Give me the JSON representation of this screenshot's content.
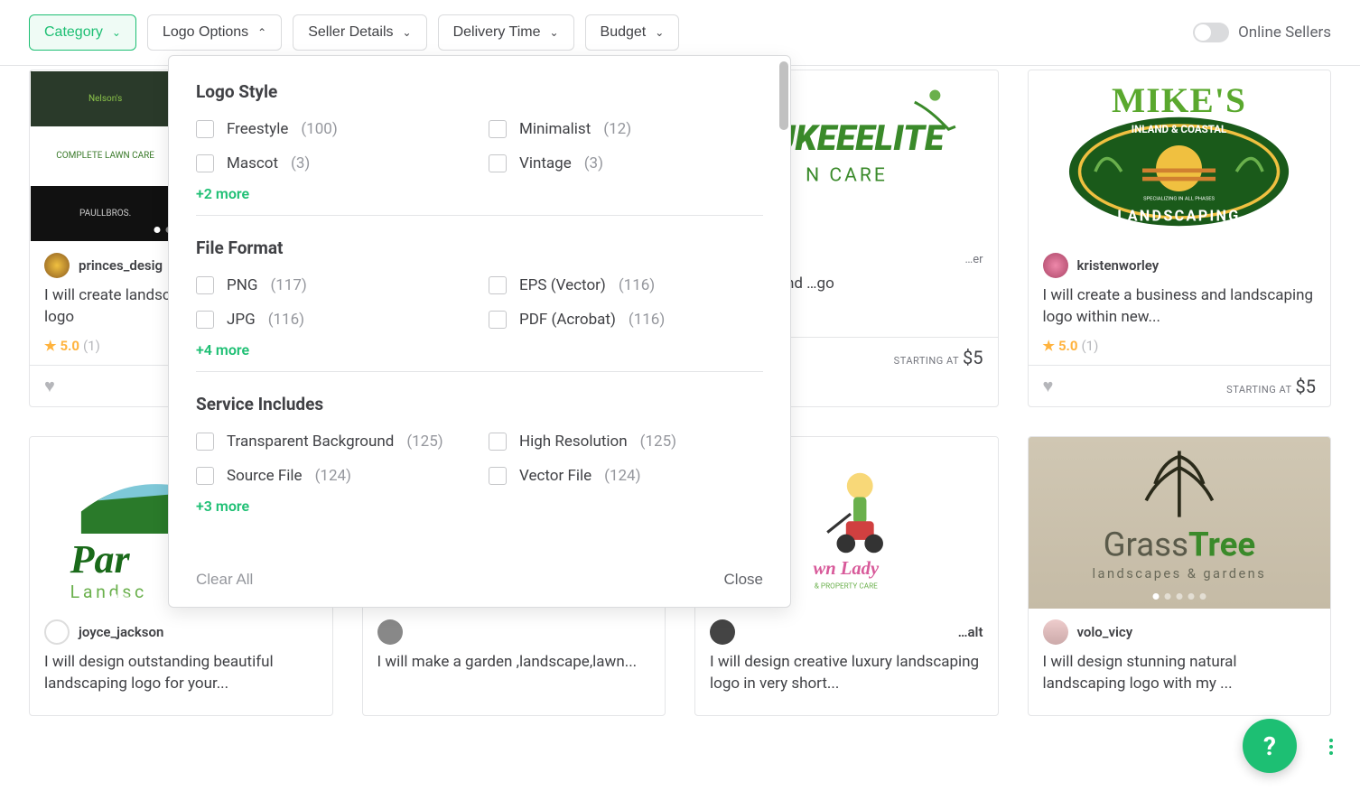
{
  "filters": {
    "category": "Category",
    "logo_options": "Logo Options",
    "seller_details": "Seller Details",
    "delivery_time": "Delivery Time",
    "budget": "Budget",
    "online_sellers": "Online Sellers"
  },
  "dropdown": {
    "sections": [
      {
        "title": "Logo Style",
        "options": [
          {
            "label": "Freestyle",
            "count": "(100)"
          },
          {
            "label": "Minimalist",
            "count": "(12)"
          },
          {
            "label": "Mascot",
            "count": "(3)"
          },
          {
            "label": "Vintage",
            "count": "(3)"
          }
        ],
        "more": "+2 more"
      },
      {
        "title": "File Format",
        "options": [
          {
            "label": "PNG",
            "count": "(117)"
          },
          {
            "label": "EPS (Vector)",
            "count": "(116)"
          },
          {
            "label": "JPG",
            "count": "(116)"
          },
          {
            "label": "PDF (Acrobat)",
            "count": "(116)"
          }
        ],
        "more": "+4 more"
      },
      {
        "title": "Service Includes",
        "options": [
          {
            "label": "Transparent Background",
            "count": "(125)"
          },
          {
            "label": "High Resolution",
            "count": "(125)"
          },
          {
            "label": "Source File",
            "count": "(124)"
          },
          {
            "label": "Vector File",
            "count": "(124)"
          }
        ],
        "more": "+3 more"
      }
    ],
    "clear": "Clear All",
    "close": "Close"
  },
  "gigs_row1": [
    {
      "seller": "princes_desig",
      "title": "I will create landscaping and lawn care logo",
      "rating": "5.0",
      "rating_count": "(1)",
      "price_label": "",
      "price": ""
    },
    {
      "seller": "",
      "title": "",
      "rating": "",
      "rating_count": "",
      "price_label": "",
      "price": ""
    },
    {
      "seller": "…er",
      "title": "…wn care and …go",
      "rating": "",
      "rating_count": "",
      "price_label": "STARTING AT",
      "price": "$5"
    },
    {
      "seller": "kristenworley",
      "title": "I will create a business and landscaping logo within new...",
      "rating": "5.0",
      "rating_count": "(1)",
      "price_label": "STARTING AT",
      "price": "$5"
    }
  ],
  "gigs_row2": [
    {
      "seller": "joyce_jackson",
      "title": "I will design outstanding beautiful landscaping logo for your..."
    },
    {
      "seller": "",
      "title": "I will make a garden ,landscape,lawn..."
    },
    {
      "seller": "…alt",
      "title": "I will design creative luxury landscaping logo in very short..."
    },
    {
      "seller": "volo_vicy",
      "title": "I will design stunning natural landscaping logo with my ..."
    }
  ],
  "help": "?"
}
